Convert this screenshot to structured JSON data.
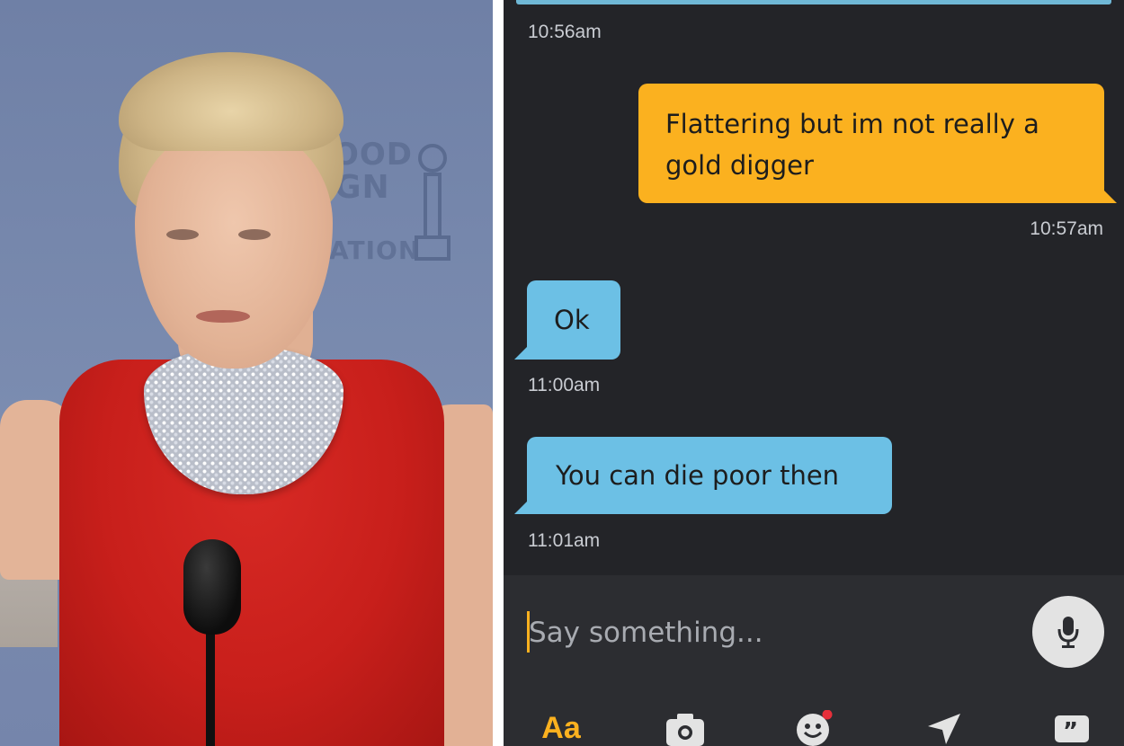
{
  "photo": {
    "backdrop_lines": [
      "OOD",
      "GN",
      "ATION"
    ]
  },
  "chat": {
    "messages": [
      {
        "direction": "out",
        "text_line1": "Flattering but im not really a",
        "text_line2": "gold digger",
        "time": "10:57am"
      },
      {
        "direction": "in",
        "text": "Ok",
        "time": "11:00am"
      },
      {
        "direction": "in",
        "text": "You can die poor then",
        "time": "11:01am"
      }
    ],
    "earlier_time": "10:56am",
    "composer": {
      "placeholder": "Say something...",
      "text_style_label": "Aa"
    },
    "toolbar_icons": [
      "camera-icon",
      "emoji-icon",
      "location-send-icon",
      "quote-icon"
    ],
    "colors": {
      "background": "#232428",
      "outgoing_bubble": "#fbb11f",
      "incoming_bubble": "#6cc0e5",
      "accent": "#fbb11f"
    }
  }
}
